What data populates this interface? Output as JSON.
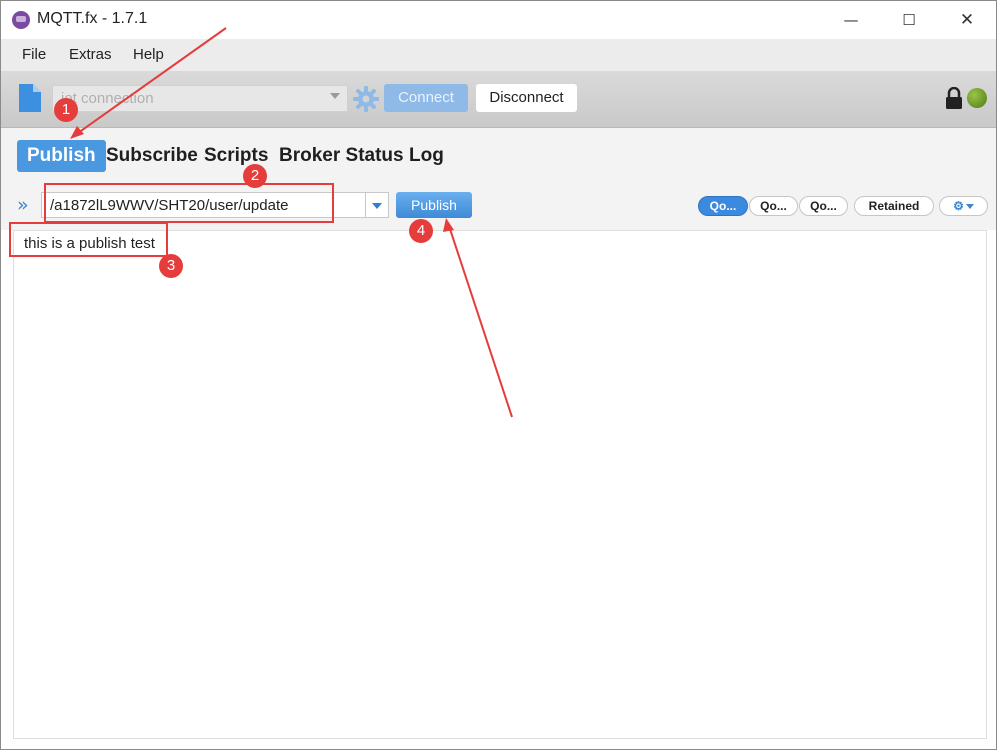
{
  "window": {
    "title": "MQTT.fx - 1.7.1"
  },
  "menubar": {
    "items": [
      "File",
      "Extras",
      "Help"
    ]
  },
  "toolbar": {
    "connection_profile": "iot connection",
    "connect_label": "Connect",
    "disconnect_label": "Disconnect",
    "status": "connected"
  },
  "tabs": [
    "Publish",
    "Subscribe",
    "Scripts",
    "Broker Status",
    "Log"
  ],
  "active_tab": "Publish",
  "publish": {
    "topic": "/a1872lL9WWV/SHT20/user/update",
    "publish_label": "Publish",
    "qos_options": [
      "Qo...",
      "Qo...",
      "Qo..."
    ],
    "qos_selected": 0,
    "retained_label": "Retained",
    "payload": "this is a publish test"
  },
  "annotations": {
    "step_labels": [
      "1",
      "2",
      "3",
      "4"
    ],
    "color": "#e53c3c"
  },
  "colors": {
    "accent": "#4a98e0",
    "connected": "#6a9a1f"
  }
}
